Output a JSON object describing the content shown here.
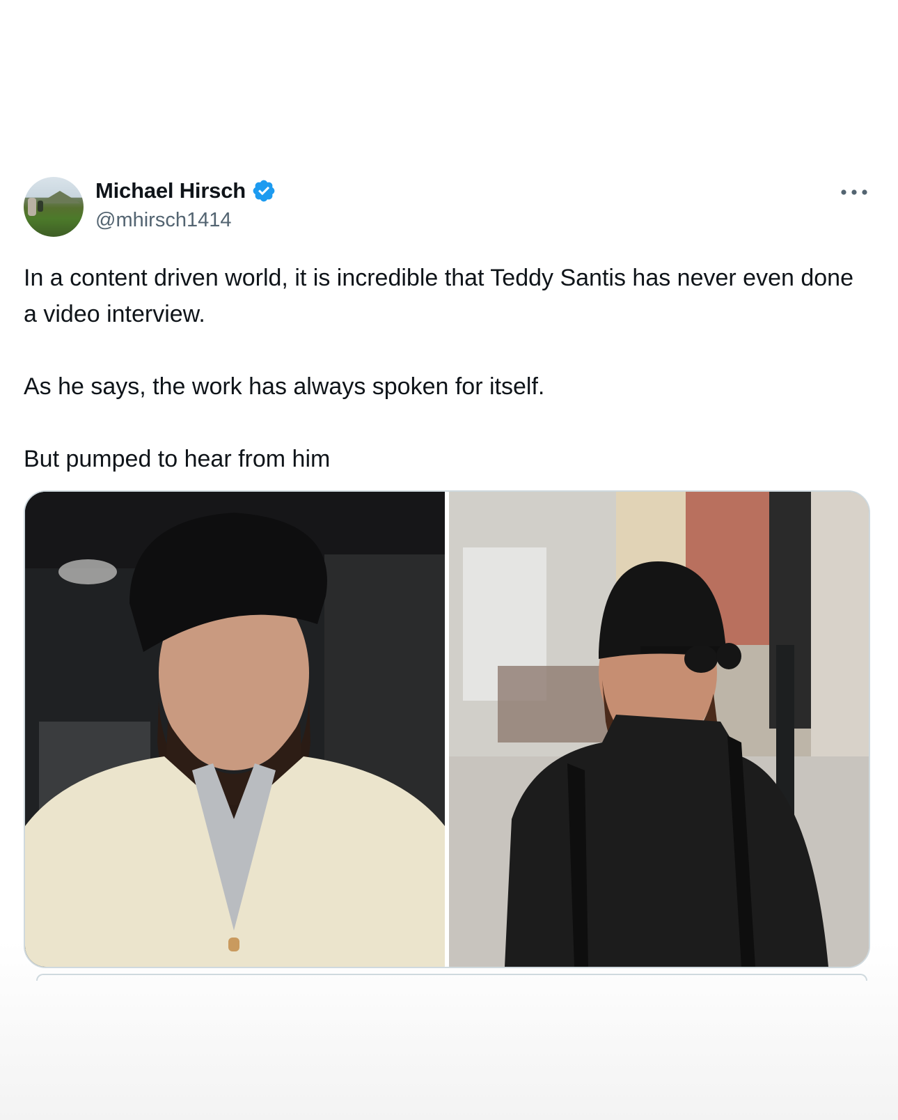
{
  "author": {
    "name": "Michael Hirsch",
    "handle": "@mhirsch1414",
    "verified": true,
    "avatar": "avatar-landscape-photo"
  },
  "post": {
    "paragraphs": [
      "In a content driven world, it is incredible that Teddy Santis has never even done a video interview.",
      "As he says, the work has always spoken for itself.",
      "But pumped to hear from him"
    ]
  },
  "media": {
    "images": [
      {
        "icon": "portrait-photo-cardigan"
      },
      {
        "icon": "street-photo-sunglasses"
      }
    ]
  },
  "icons": {
    "verified": "verified-badge-icon",
    "more": "more-options-icon"
  },
  "colors": {
    "verified_blue": "#1d9bf0",
    "text_primary": "#0f1419",
    "text_secondary": "#536471",
    "border": "#cfd9de"
  }
}
